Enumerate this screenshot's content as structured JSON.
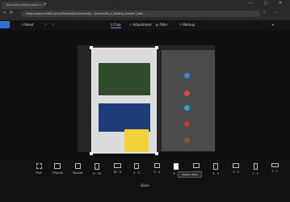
{
  "browser": {
    "tab_title": "Microsoft is testing sleeper t…",
    "address": "https://www.reddit.com/r/Microsoft/comments/…/microsoft_is_testing_sleeper_tabs…"
  },
  "toolbar": {
    "reset_label": "Reset",
    "crop_label": "Crop",
    "adjustment_label": "Adjustment",
    "filter_label": "Filter",
    "markup_label": "Markup"
  },
  "crop_ratios": [
    {
      "label": "Free"
    },
    {
      "label": "Original"
    },
    {
      "label": "Square"
    },
    {
      "label": "9 : 16"
    },
    {
      "label": "16 : 9"
    },
    {
      "label": "4 : 5"
    },
    {
      "label": "5 : 4"
    },
    {
      "label": "3 : 4"
    },
    {
      "label": "4 : 3"
    },
    {
      "label": "2 : 3"
    },
    {
      "label": "3 : 2"
    },
    {
      "label": "1 : 2"
    },
    {
      "label": "2 : 1"
    }
  ],
  "tooltip": "Aspect ratios",
  "done_label": "Done",
  "colors": {
    "accent": "#4aa3ff",
    "toolbar_blue": "#2f6fd6"
  }
}
